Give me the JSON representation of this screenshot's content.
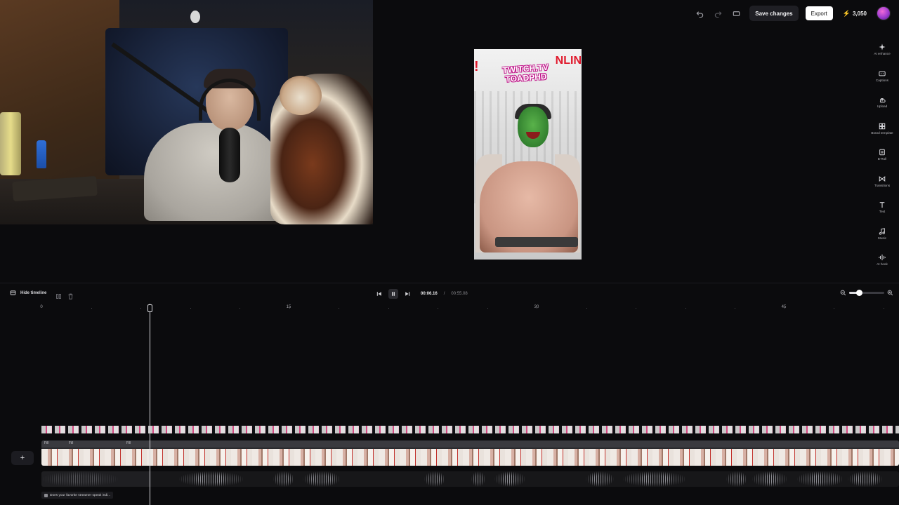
{
  "topbar": {
    "save_label": "Save changes",
    "export_label": "Export",
    "credits": "3,050",
    "icons": [
      "undo-icon",
      "redo-icon",
      "aspect-ratio-icon",
      "bolt-icon"
    ]
  },
  "rail": {
    "items": [
      {
        "label": "AI enhance",
        "icon": "sparkle-icon"
      },
      {
        "label": "Captions",
        "icon": "captions-icon"
      },
      {
        "label": "Upload",
        "icon": "upload-icon"
      },
      {
        "label": "Brand template",
        "icon": "brand-template-icon"
      },
      {
        "label": "B-Roll",
        "icon": "broll-icon"
      },
      {
        "label": "Transitions",
        "icon": "transitions-icon"
      },
      {
        "label": "Text",
        "icon": "text-icon"
      },
      {
        "label": "Music",
        "icon": "music-icon"
      },
      {
        "label": "AI hook",
        "icon": "ai-hook-icon"
      }
    ]
  },
  "preview": {
    "banner_line1": "TWITCH.TV",
    "banner_line2": "TOADPHD",
    "red_left": "!",
    "red_right": "NLIN"
  },
  "timeline": {
    "hide_label": "Hide timeline",
    "current_time": "00:06.16",
    "separator": "/",
    "duration": "00:55.08",
    "zoom_level": 0.28,
    "ruler_labels": [
      "0",
      "15",
      "30",
      "45"
    ],
    "segment_labels": [
      "Fill",
      "Fill",
      "Fill"
    ],
    "clip_title": "Does your favorite streamer speak indi..."
  },
  "colors": {
    "background": "#0b0b0d",
    "accent_bolt": "#f5c02a",
    "export_bg": "#ffffff"
  }
}
